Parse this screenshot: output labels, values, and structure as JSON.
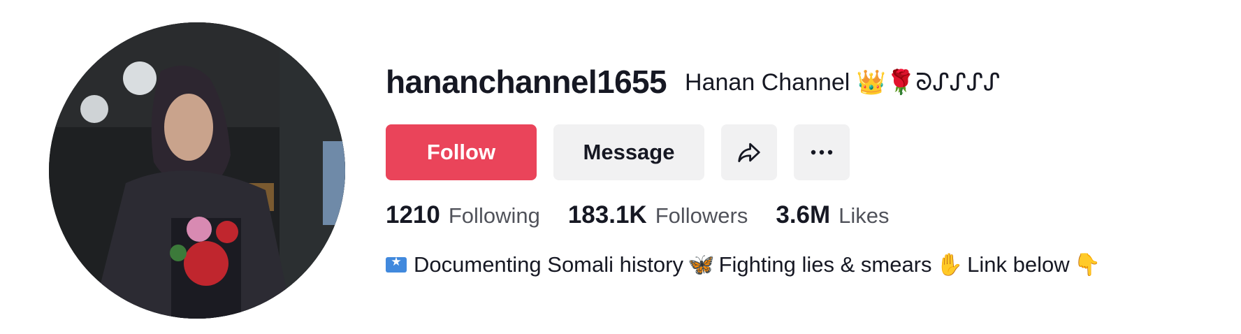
{
  "profile": {
    "username": "hananchannel1655",
    "nickname": "Hanan Channel 👑🌹ᘐᔑᔑᔑᔑ",
    "buttons": {
      "follow": "Follow",
      "message": "Message"
    },
    "icons": {
      "share": "share-icon",
      "more": "more-icon"
    },
    "stats": [
      {
        "number": "1210",
        "label": "Following"
      },
      {
        "number": "183.1K",
        "label": "Followers"
      },
      {
        "number": "3.6M",
        "label": "Likes"
      }
    ],
    "bio": {
      "text_1": "Documenting Somali history",
      "text_2": "Fighting lies & smears",
      "text_3": "Link below"
    },
    "colors": {
      "follow_bg": "#ea445a",
      "button_bg": "#f1f1f2",
      "text": "#161823"
    }
  }
}
